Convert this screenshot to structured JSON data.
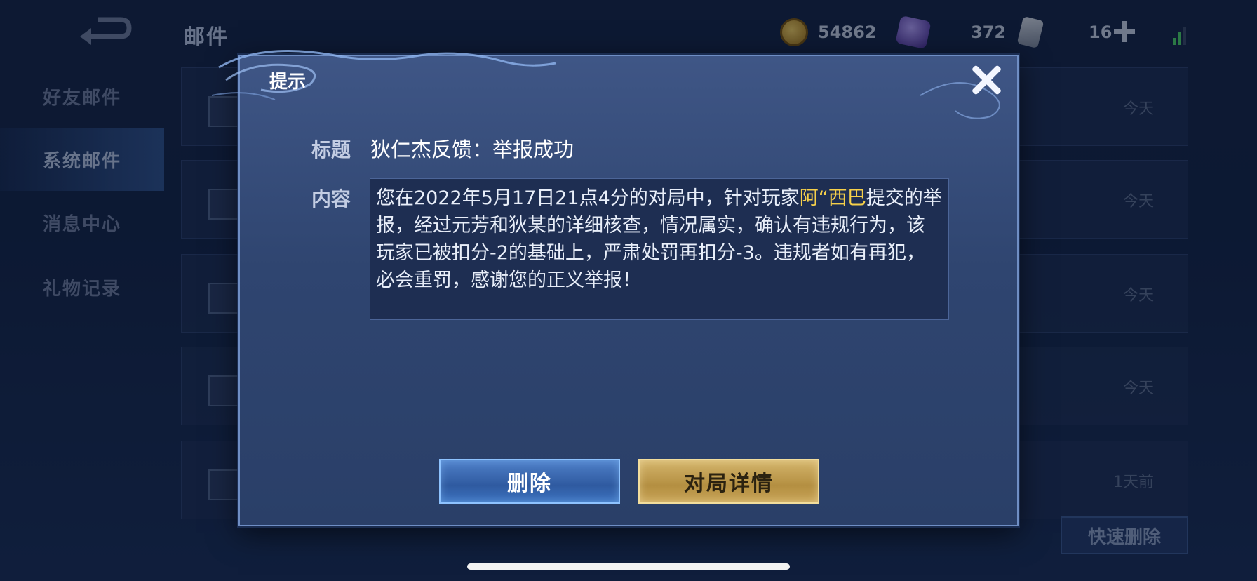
{
  "header": {
    "title": "邮件",
    "gold": "54862",
    "gems": "372",
    "tickets": "16"
  },
  "sidebar": {
    "items": [
      {
        "label": "好友邮件"
      },
      {
        "label": "系统邮件",
        "active": true
      },
      {
        "label": "消息中心"
      },
      {
        "label": "礼物记录"
      }
    ]
  },
  "mail_list": {
    "rows": [
      {
        "date": "今天"
      },
      {
        "date": "今天"
      },
      {
        "date": "今天"
      },
      {
        "date": "今天"
      },
      {
        "date": "1天前"
      }
    ],
    "quick_delete_label": "快速删除"
  },
  "dialog": {
    "title": "提示",
    "subject_label": "标题",
    "subject": "狄仁杰反馈：举报成功",
    "content_label": "内容",
    "content_prefix": "您在2022年5月17日21点4分的对局中，针对玩家",
    "player_name": "阿“西巴",
    "content_suffix": "提交的举报，经过元芳和狄某的详细核查，情况属实，确认有违规行为，该玩家已被扣分-2的基础上，严肃处罚再扣分-3。违规者如有再犯，必会重罚，感谢您的正义举报！",
    "delete_label": "删除",
    "details_label": "对局详情"
  },
  "colors": {
    "highlight": "#f6d04a",
    "dialog_bg": "#34497a",
    "delete_btn": "#3d6fb8",
    "details_btn": "#c4a257"
  },
  "icons": [
    "back-icon",
    "gold-coin-icon",
    "gem-icon",
    "ticket-icon",
    "plus-icon",
    "signal-icon",
    "envelope-icon",
    "close-icon"
  ]
}
